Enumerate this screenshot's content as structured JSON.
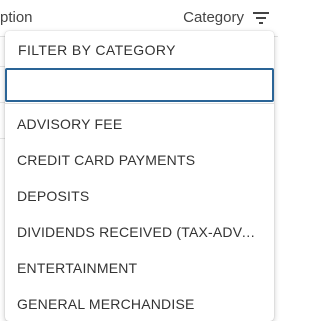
{
  "header": {
    "description_col": "ption",
    "category_col": "Category",
    "filter_icon": "filter-icon"
  },
  "dropdown": {
    "title": "FILTER BY CATEGORY",
    "search_value": "",
    "search_placeholder": "",
    "options": [
      "ADVISORY FEE",
      "CREDIT CARD PAYMENTS",
      "DEPOSITS",
      "DIVIDENDS RECEIVED (TAX-ADVANTAGED)",
      "ENTERTAINMENT",
      "GENERAL MERCHANDISE"
    ]
  },
  "colors": {
    "focus_border": "#2a6496",
    "text": "#333333"
  }
}
